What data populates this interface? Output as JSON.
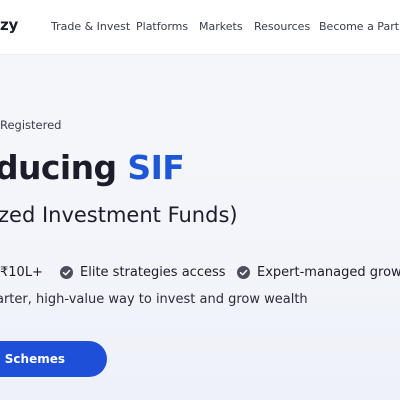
{
  "header": {
    "brand": "zy",
    "nav": [
      "Trade & Invest",
      "Platforms",
      "Markets",
      "Resources",
      "Become a Partne"
    ]
  },
  "hero": {
    "registered": "Registered",
    "headline_prefix": "ducing ",
    "headline_accent": "SIF",
    "subhead": "zed Investment Funds)",
    "features": [
      "₹10L+",
      "Elite strategies access",
      "Expert-managed growt"
    ],
    "tagline": "arter, high-value way to invest and grow wealth",
    "cta_label": "SIF Schemes"
  },
  "colors": {
    "accent": "#1e56d6",
    "cta": "#1d4fd8",
    "check_icon": "#4b4f5c"
  },
  "icons": [
    "check-circle-icon"
  ]
}
